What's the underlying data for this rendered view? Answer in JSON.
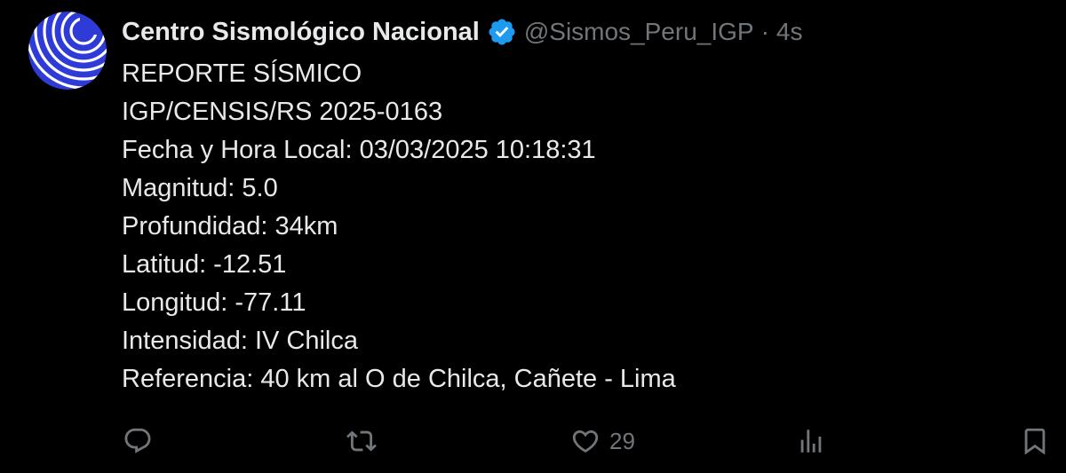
{
  "tweet": {
    "author_name": "Centro Sismológico Nacional",
    "handle": "@Sismos_Peru_IGP",
    "separator": "·",
    "time": "4s",
    "lines": [
      "REPORTE SÍSMICO",
      "IGP/CENSIS/RS 2025-0163",
      "Fecha y Hora Local: 03/03/2025 10:18:31",
      "Magnitud: 5.0",
      "Profundidad: 34km",
      "Latitud: -12.51",
      "Longitud: -77.11",
      "Intensidad: IV Chilca",
      "Referencia: 40 km al O de Chilca, Cañete - Lima"
    ],
    "actions": {
      "reply_icon": "reply-icon",
      "retweet_icon": "retweet-icon",
      "like_icon": "heart-icon",
      "like_count": "29",
      "views_icon": "views-icon",
      "bookmark_icon": "bookmark-icon"
    }
  },
  "colors": {
    "background": "#000000",
    "text": "#e7e9ea",
    "secondary": "#71767b",
    "verified": "#1d9bf0",
    "avatar_blue": "#2e3bd6"
  }
}
